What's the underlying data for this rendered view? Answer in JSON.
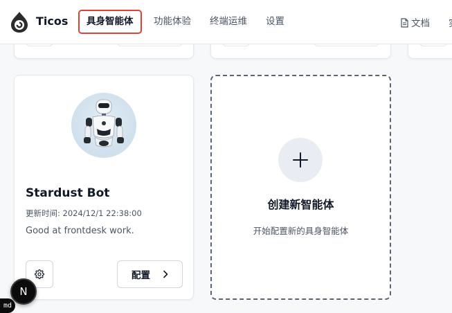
{
  "header": {
    "brand": "Ticos",
    "nav": [
      {
        "label": "具身智能体",
        "active": true
      },
      {
        "label": "功能体验",
        "active": false
      },
      {
        "label": "终端运维",
        "active": false
      },
      {
        "label": "设置",
        "active": false
      }
    ],
    "doc_label": "文档",
    "cut_label": "实"
  },
  "agent_card": {
    "name": "Stardust Bot",
    "updated": "更新时间: 2024/12/1 22:38:00",
    "description": "Good at frontdesk work.",
    "config_label": "配置"
  },
  "create_card": {
    "title": "创建新智能体",
    "subtitle": "开始配置新的具身智能体"
  },
  "fab_label": "N",
  "md_badge": "md",
  "colors": {
    "active_outline": "#e2412f",
    "dashed_border": "#5b6476"
  }
}
